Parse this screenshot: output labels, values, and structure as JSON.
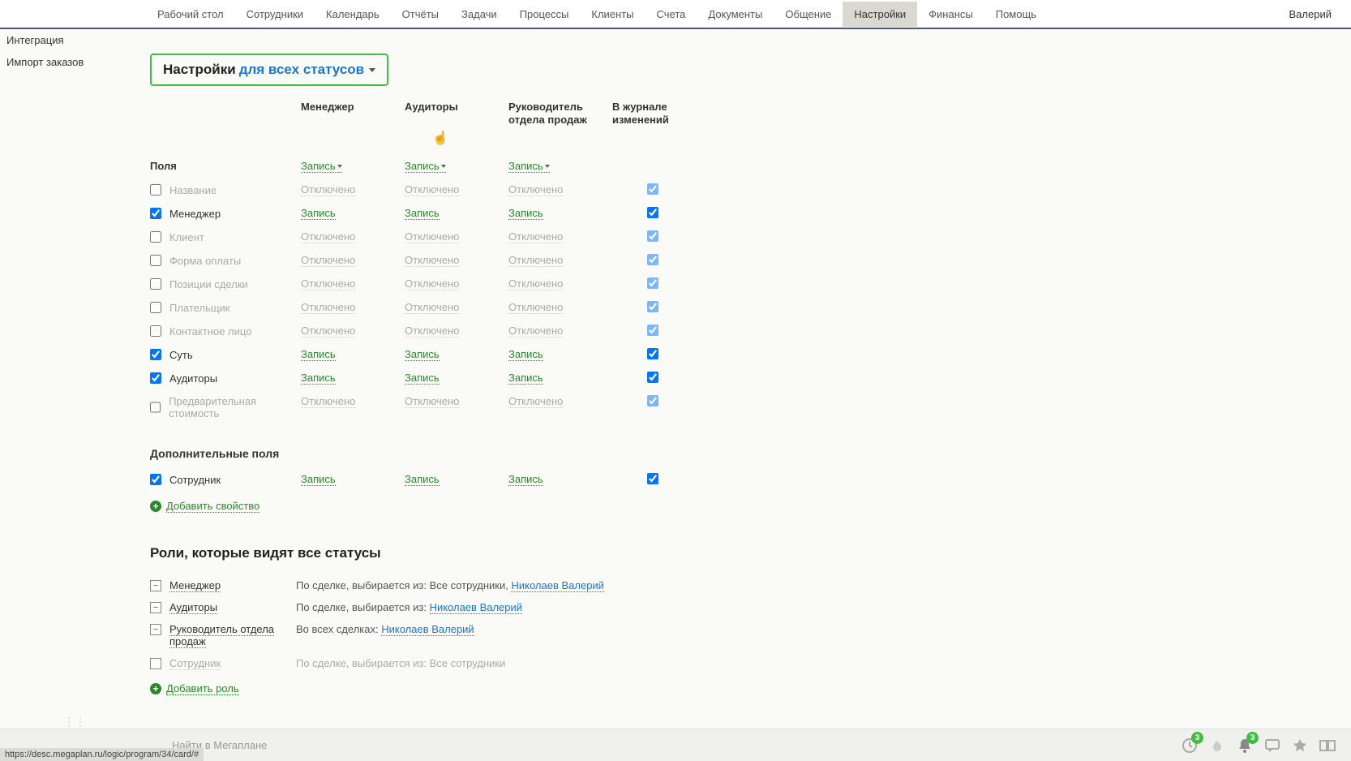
{
  "nav": {
    "items": [
      "Рабочий стол",
      "Сотрудники",
      "Календарь",
      "Отчёты",
      "Задачи",
      "Процессы",
      "Клиенты",
      "Счета",
      "Документы",
      "Общение",
      "Настройки",
      "Финансы",
      "Помощь"
    ],
    "active": "Настройки",
    "user": "Валерий"
  },
  "sidebar": {
    "items": [
      "Интеграция",
      "Импорт заказов"
    ]
  },
  "settings_dropdown": {
    "prefix": "Настройки",
    "link": "для всех статусов"
  },
  "columns": {
    "fields": "Поля",
    "manager": "Менеджер",
    "auditors": "Аудиторы",
    "head": "Руководитель отдела продаж",
    "journal": "В журнале изменений"
  },
  "header_values": {
    "manager": "Запись",
    "auditors": "Запись",
    "head": "Запись"
  },
  "value_labels": {
    "on": "Запись",
    "off": "Отключено"
  },
  "rows": [
    {
      "label": "Название",
      "checked": false,
      "manager": "off",
      "auditors": "off",
      "head": "off",
      "journal": true,
      "journal_dim": true
    },
    {
      "label": "Менеджер",
      "checked": true,
      "manager": "on",
      "auditors": "on",
      "head": "on",
      "journal": true,
      "journal_dim": false
    },
    {
      "label": "Клиент",
      "checked": false,
      "manager": "off",
      "auditors": "off",
      "head": "off",
      "journal": true,
      "journal_dim": true
    },
    {
      "label": "Форма оплаты",
      "checked": false,
      "manager": "off",
      "auditors": "off",
      "head": "off",
      "journal": true,
      "journal_dim": true
    },
    {
      "label": "Позиции сделки",
      "checked": false,
      "manager": "off",
      "auditors": "off",
      "head": "off",
      "journal": true,
      "journal_dim": true
    },
    {
      "label": "Плательщик",
      "checked": false,
      "manager": "off",
      "auditors": "off",
      "head": "off",
      "journal": true,
      "journal_dim": true
    },
    {
      "label": "Контактное лицо",
      "checked": false,
      "manager": "off",
      "auditors": "off",
      "head": "off",
      "journal": true,
      "journal_dim": true
    },
    {
      "label": "Суть",
      "checked": true,
      "manager": "on",
      "auditors": "on",
      "head": "on",
      "journal": true,
      "journal_dim": false
    },
    {
      "label": "Аудиторы",
      "checked": true,
      "manager": "on",
      "auditors": "on",
      "head": "on",
      "journal": true,
      "journal_dim": false
    },
    {
      "label": "Предварительная стоимость",
      "checked": false,
      "manager": "off",
      "auditors": "off",
      "head": "off",
      "journal": true,
      "journal_dim": true
    }
  ],
  "extra_section": {
    "title": "Дополнительные поля",
    "rows": [
      {
        "label": "Сотрудник",
        "checked": true,
        "manager": "on",
        "auditors": "on",
        "head": "on",
        "journal": true,
        "journal_dim": false
      }
    ],
    "add": "Добавить свойство"
  },
  "roles_section": {
    "title": "Роли, которые видят все статусы",
    "rows": [
      {
        "toggle": "minus",
        "name": "Менеджер",
        "desc_prefix": "По сделке, выбирается из: Все сотрудники, ",
        "user": "Николаев Валерий",
        "disabled": false
      },
      {
        "toggle": "minus",
        "name": "Аудиторы",
        "desc_prefix": "По сделке, выбирается из: ",
        "user": "Николаев Валерий",
        "disabled": false
      },
      {
        "toggle": "minus",
        "name": "Руководитель отдела продаж",
        "desc_prefix": "Во всех сделках: ",
        "user": "Николаев Валерий",
        "disabled": false
      },
      {
        "toggle": "empty",
        "name": "Сотрудник",
        "desc_prefix": "По сделке, выбирается из: Все сотрудники",
        "user": "",
        "disabled": true
      }
    ],
    "add": "Добавить роль"
  },
  "bottom": {
    "search_placeholder": "Найти в Мегаплане",
    "badges": {
      "clock": "3",
      "bell": "3"
    }
  },
  "status_url": "https://desc.megaplan.ru/logic/program/34/card/#"
}
